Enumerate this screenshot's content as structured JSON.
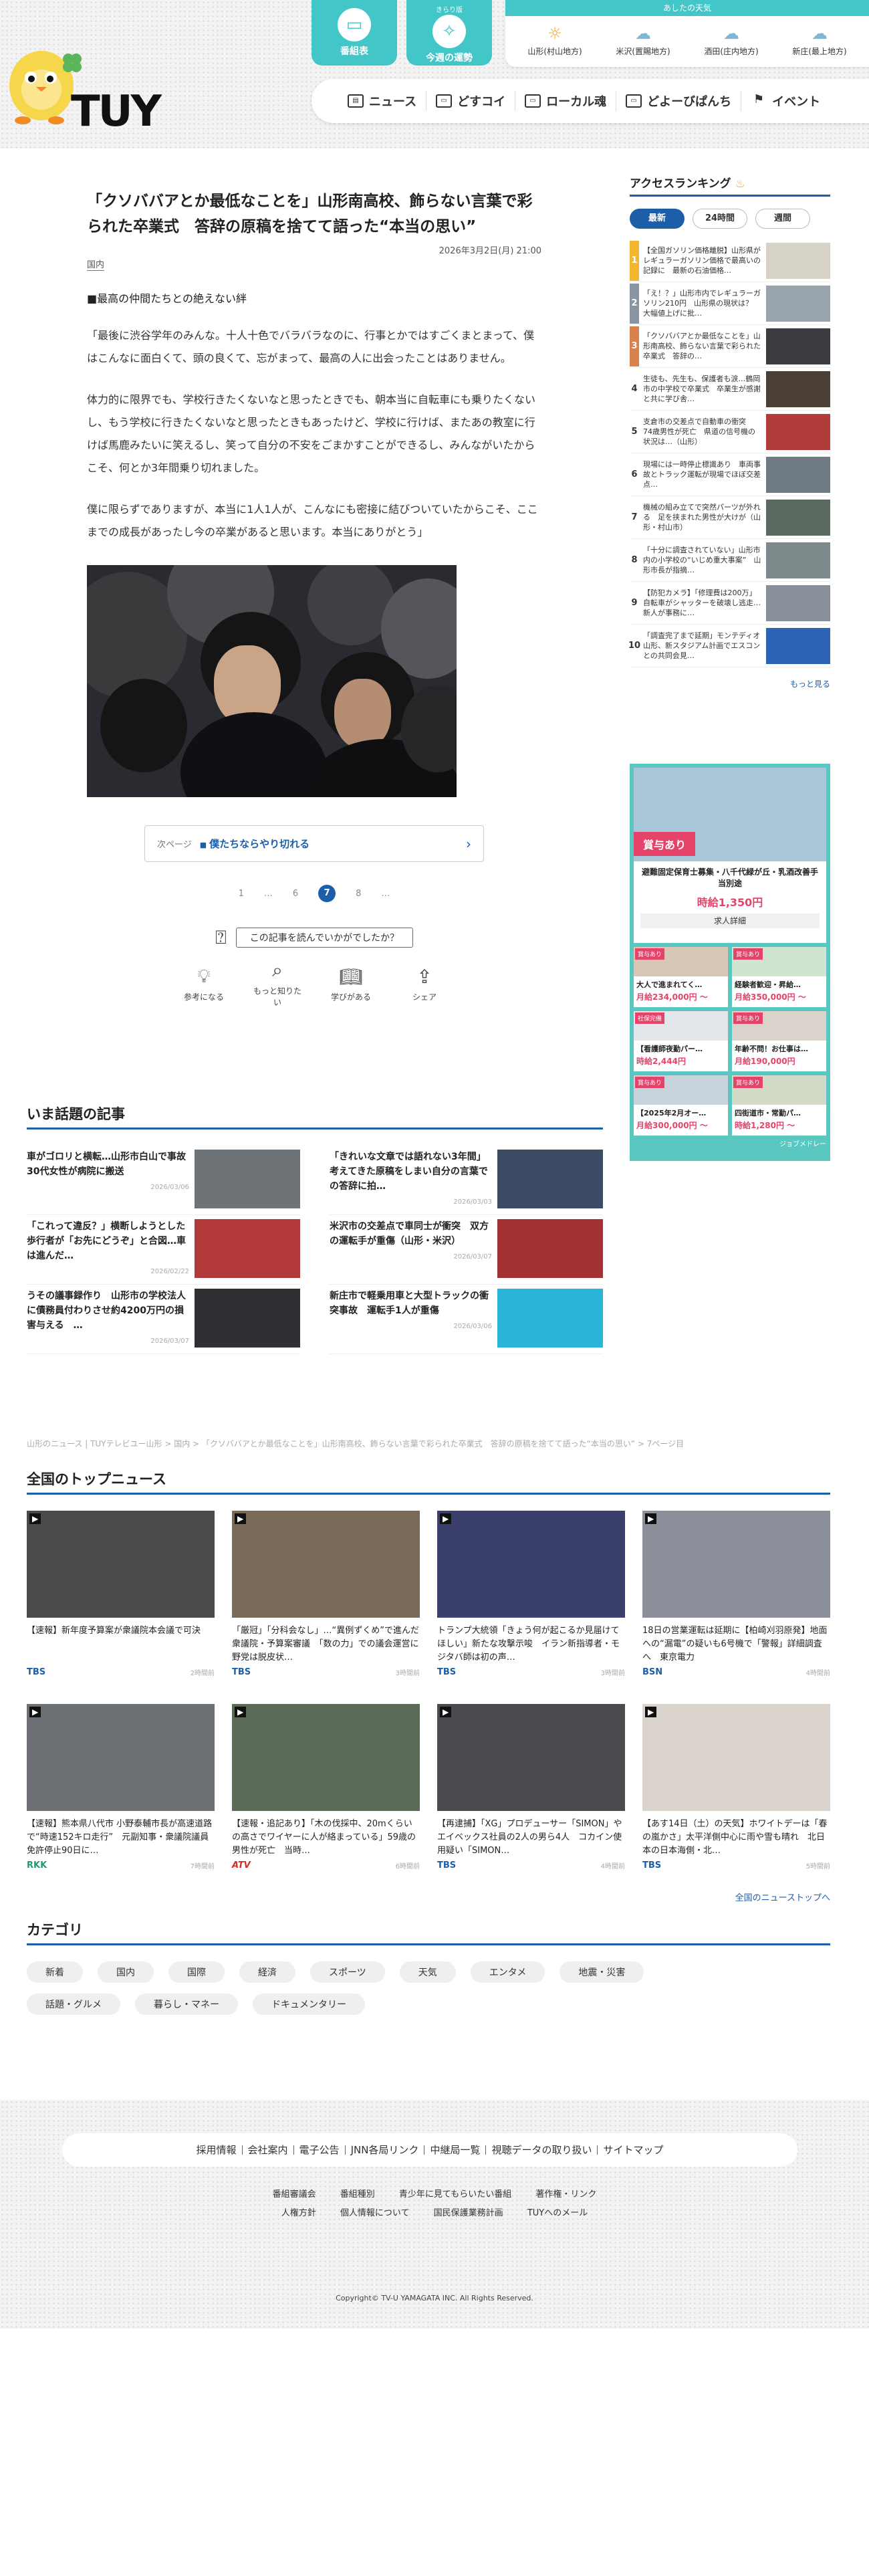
{
  "header": {
    "logo_text": "TUY",
    "btn_schedule": {
      "label": "番組表",
      "icon": "tv-icon"
    },
    "btn_fortune": {
      "small": "きらり版",
      "label": "今週の運勢",
      "icon": "horoscope-icon"
    },
    "weather": {
      "title": "あしたの天気",
      "items": [
        {
          "name": "山形(村山地方)",
          "icon": "cloud-sun-icon"
        },
        {
          "name": "米沢(置賜地方)",
          "icon": "cloud-icon"
        },
        {
          "name": "酒田(庄内地方)",
          "icon": "cloud-icon"
        },
        {
          "name": "新庄(最上地方)",
          "icon": "cloud-icon"
        }
      ]
    },
    "nav": [
      "ニュース",
      "どすコイ",
      "ローカル魂",
      "どよーびぱんち",
      "イベント"
    ]
  },
  "article": {
    "title": "「クソババアとか最低なことを」山形南高校、飾らない言葉で彩られた卒業式　答辞の原稿を捨てて語った“本当の思い”",
    "date": "2026年3月2日(月) 21:00",
    "category": "国内",
    "subheading": "■最高の仲間たちとの絶えない絆",
    "paragraphs": [
      "「最後に渋谷学年のみんな。十人十色でバラバラなのに、行事とかではすごくまとまって、僕はこんなに面白くて、頭の良くて、忘がまって、最高の人に出会ったことはありません。",
      "体力的に限界でも、学校行きたくないなと思ったときでも、朝本当に自転車にも乗りたくないし、もう学校に行きたくないなと思ったときもあったけど、学校に行けば、またあの教室に行けば馬鹿みたいに笑えるし、笑って自分の不安をごまかすことができるし、みんながいたからこそ、何とか3年間乗り切れました。",
      "僕に限らずでありますが、本当に1人1人が、こんなにも密接に結びついていたからこそ、ここまでの成長があったし今の卒業があると思います。本当にありがとう」"
    ],
    "next_label": "次ページ",
    "next_title": "僕たちならやり切れる",
    "pager": [
      "1",
      "…",
      "6",
      "7",
      "8",
      "…"
    ],
    "pager_current": "7",
    "reaction_prompt": "この記事を読んでいかがでしたか？",
    "reactions": [
      {
        "label": "参考になる",
        "icon": "lightbulb-icon"
      },
      {
        "label": "もっと知りたい",
        "icon": "magnifier-icon"
      },
      {
        "label": "学びがある",
        "icon": "book-icon"
      },
      {
        "label": "シェア",
        "icon": "share-icon"
      }
    ]
  },
  "ranking": {
    "title": "アクセスランキング",
    "tabs": [
      "最新",
      "24時間",
      "週間"
    ],
    "items": [
      {
        "n": "1",
        "title": "【全国ガソリン価格離脱】山形県がレギュラーガソリン価格で最高いの記録に　最新の石油価格…"
      },
      {
        "n": "2",
        "title": "「え！？」山形市内でレギュラーガソリン210円　山形県の現状は？　大幅値上げに批…"
      },
      {
        "n": "3",
        "title": "「クソババアとか最低なことを」山形南高校、飾らない言葉で彩られた卒業式　答辞の…"
      },
      {
        "n": "4",
        "title": "生徒も、先生も、保護者も涙…鶴岡市の中学校で卒業式　卒業生が感謝と共に学び舎…"
      },
      {
        "n": "5",
        "title": "支倉市の交差点で自動車の衝突　74歳男性が死亡　県道の信号機の状況は…（山形）"
      },
      {
        "n": "6",
        "title": "現場には一時停止標識あり　車両事故とトラック運転が現場でほぼ交差点…"
      },
      {
        "n": "7",
        "title": "機械の組み立てで突然パーツが外れる　足を挟まれた男性が大けが（山形・村山市）"
      },
      {
        "n": "8",
        "title": "「十分に調査されていない」山形市内の小学校の“いじめ重大事案”　山形市長が指摘…"
      },
      {
        "n": "9",
        "title": "【防犯カメラ】「修理費は200万」自転車がシャッターを破壊し逃走…新人が事務に…"
      },
      {
        "n": "10",
        "title": "「調査完了まで延期」モンテディオ山形、新スタジアム計画でエスコンとの共同会見…"
      }
    ],
    "more": "もっと見る"
  },
  "jobs": {
    "featured": {
      "badge": "賞与あり",
      "title": "避難固定保育士募集・八千代緑が丘・乳酒改善手当別途",
      "pay": "時給1,350円",
      "detail": "求人詳細"
    },
    "cells": [
      {
        "badge": "賞与あり",
        "title": "大人で進まれてく…",
        "pay": "月給234,000円 〜"
      },
      {
        "badge": "賞与あり",
        "title": "経験者歓迎・昇給…",
        "pay": "月給350,000円 〜"
      },
      {
        "badge": "社保完備",
        "title": "【看護師夜勤パー…",
        "pay": "時給2,444円"
      },
      {
        "badge": "賞与あり",
        "title": "年齢不問！お仕事は…",
        "pay": "月給190,000円"
      },
      {
        "badge": "賞与あり",
        "title": "【2025年2月オー…",
        "pay": "月給300,000円 〜"
      },
      {
        "badge": "賞与あり",
        "title": "四街道市・常勤パ…",
        "pay": "時給1,280円 〜"
      }
    ],
    "footer": "ジョブメドレー"
  },
  "topics": {
    "title": "いま話題の記事",
    "items": [
      {
        "title": "車がゴロリと横転…山形市白山で事故　30代女性が病院に搬送",
        "date": "2026/03/06"
      },
      {
        "title": "「きれいな文章では語れない3年間」考えてきた原稿をしまい自分の言葉での答辞に拍…",
        "date": "2026/03/03"
      },
      {
        "title": "「これって違反？」横断しようとした歩行者が「お先にどうぞ」と合図…車は進んだ…",
        "date": "2026/02/22"
      },
      {
        "title": "米沢市の交差点で車同士が衝突　双方の運転手が重傷（山形・米沢）",
        "date": "2026/03/07"
      },
      {
        "title": "うその議事録作り　山形市の学校法人に債務員付わりさせ約4200万円の損害与える　…",
        "date": "2026/03/07"
      },
      {
        "title": "新庄市で軽乗用車と大型トラックの衝突事故　運転手1人が重傷",
        "date": "2026/03/06"
      }
    ]
  },
  "breadcrumb": "山形のニュース | TUYテレビユー山形 > 国内 > 「クソババアとか最低なことを」山形南高校、飾らない言葉で彩られた卒業式　答辞の原稿を捨てて語った“本当の思い” > 7ページ目",
  "national": {
    "title": "全国のトップニュース",
    "items": [
      {
        "title": "【速報】新年度予算案が衆議院本会議で可決",
        "src": "TBS",
        "ago": "2時間前",
        "cls": ""
      },
      {
        "title": "「厳冠」「分科会なし」…“異例ずくめ”で進んだ衆議院・予算案審議　「数の力」での議会運営に野党は脱皮状…",
        "src": "TBS",
        "ago": "3時間前",
        "cls": ""
      },
      {
        "title": "トランプ大統領「きょう何が起こるか見届けてほしい」新たな攻撃示唆　イラン新指導者・モジタバ師は初の声…",
        "src": "TBS",
        "ago": "3時間前",
        "cls": ""
      },
      {
        "title": "18日の営業運転は延期に【柏崎刈羽原発】地面への“漏電”の疑いも6号機で「警報」詳細調査へ　東京電力",
        "src": "BSN",
        "ago": "4時間前",
        "cls": ""
      },
      {
        "title": "【速報】熊本県八代市 小野泰輔市長が高速道路で“時速152キロ走行”　元副知事・衆議院議員　免許停止90日に…",
        "src": "RKK",
        "ago": "7時間前",
        "cls": "rkk"
      },
      {
        "title": "【速報・追記あり】「木の伐採中、20mくらいの高さでワイヤーに人が絡まっている」59歳の男性が死亡　当時…",
        "src": "ATV",
        "ago": "6時間前",
        "cls": "atv"
      },
      {
        "title": "【再逮捕】「XG」プロデューサー「SIMON」やエイベックス社員の2人の男ら4人　コカイン使用疑い「SIMON…",
        "src": "TBS",
        "ago": "4時間前",
        "cls": ""
      },
      {
        "title": "【あす14日（土）の天気】ホワイトデーは「春の嵐かさ」太平洋側中心に雨や雪も晴れ　北日本の日本海側・北…",
        "src": "TBS",
        "ago": "5時間前",
        "cls": ""
      }
    ],
    "all": "全国のニューストップへ"
  },
  "categories": {
    "title": "カテゴリ",
    "items": [
      "新着",
      "国内",
      "国際",
      "経済",
      "スポーツ",
      "天気",
      "エンタメ",
      "地震・災害",
      "話題・グルメ",
      "暮らし・マネー",
      "ドキュメンタリー"
    ]
  },
  "footer": {
    "main_links": [
      "採用情報",
      "会社案内",
      "電子公告",
      "JNN各局リンク",
      "中継局一覧",
      "視聴データの取り扱い",
      "サイトマップ"
    ],
    "sub_links1": [
      "番組審議会",
      "番組種別",
      "青少年に見てもらいたい番組",
      "著作権・リンク"
    ],
    "sub_links2": [
      "人権方針",
      "個人情報について",
      "国民保護業務計画",
      "TUYへのメール"
    ],
    "copyright": "Copyright© TV-U YAMAGATA INC. All Rights Reserved."
  },
  "colors": {
    "accent": "#43c6c8",
    "link": "#1d5ea8",
    "job_pink": "#e6436a"
  }
}
